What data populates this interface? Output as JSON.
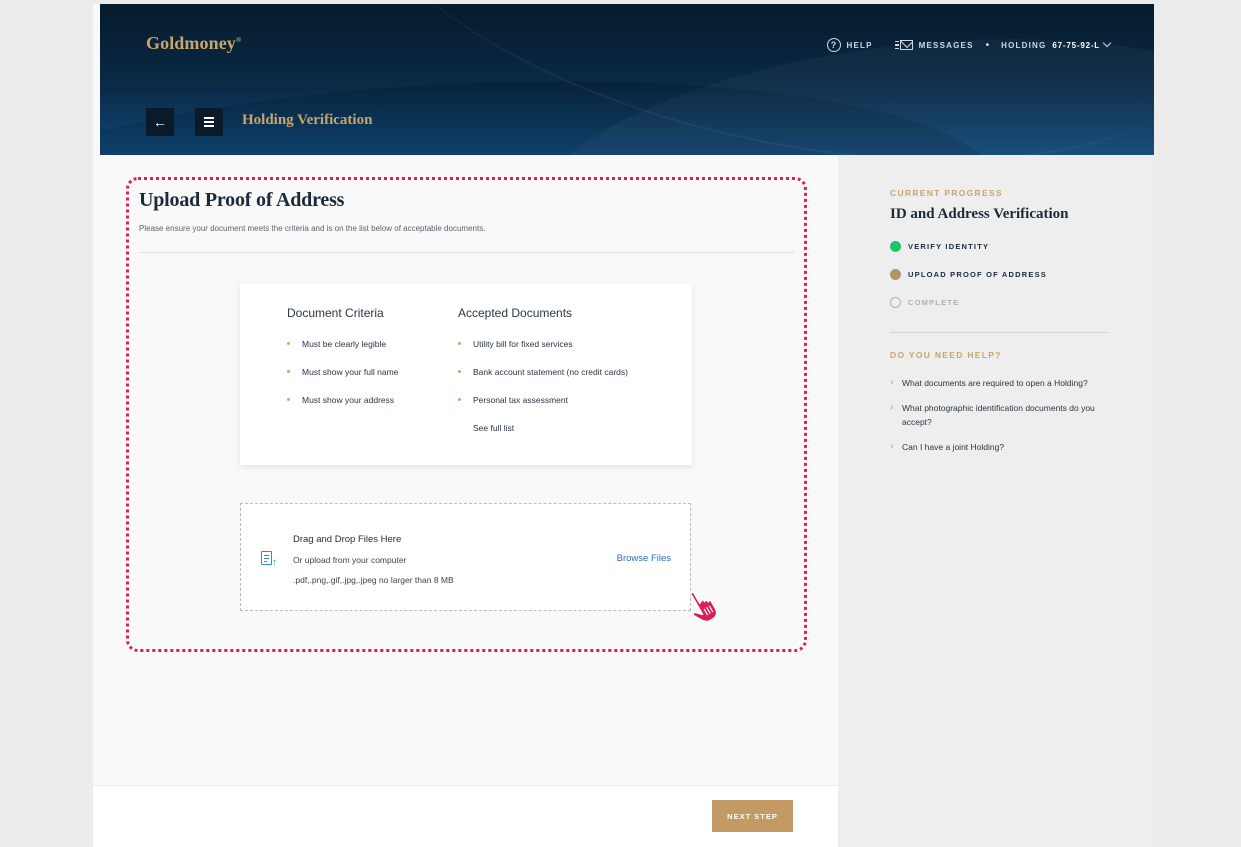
{
  "header": {
    "logo": "Goldmoney",
    "logo_mark": "®",
    "nav": {
      "help_icon": "?",
      "help_label": "HELP",
      "messages_label": "MESSAGES",
      "separator": "•",
      "holding_label": "HOLDING",
      "holding_number": "67-75-92-L"
    },
    "back_icon": "←",
    "page_title": "Holding Verification"
  },
  "main": {
    "title": "Upload Proof of Address",
    "subtitle": "Please ensure your document meets the criteria and is on the list below of acceptable documents.",
    "criteria": {
      "title": "Document Criteria",
      "items": [
        "Must be clearly legible",
        "Must show your full name",
        "Must show your address"
      ]
    },
    "accepted": {
      "title": "Accepted Documents",
      "items": [
        "Utility bill for fixed services",
        "Bank account statement (no credit cards)",
        "Personal tax assessment"
      ],
      "see_full_list": "See full list"
    },
    "upload": {
      "title": "Drag and Drop Files Here",
      "subtitle": "Or upload from your computer",
      "file_types": ".pdf,.png,.gif,.jpg,.jpeg no larger than 8 MB",
      "browse_label": "Browse Files",
      "arrow_icon": "↑"
    },
    "next_step_label": "NEXT STEP"
  },
  "sidebar": {
    "progress_label": "CURRENT PROGRESS",
    "progress_title": "ID and Address Verification",
    "steps": [
      {
        "label": "VERIFY IDENTITY",
        "status": "done",
        "color": "#1fc46d"
      },
      {
        "label": "UPLOAD PROOF OF ADDRESS",
        "status": "current",
        "color": "#b59366"
      },
      {
        "label": "COMPLETE",
        "status": "pending",
        "color": "#a9b2bc"
      }
    ],
    "help_label": "DO YOU NEED HELP?",
    "help_items": [
      "What documents are required to open a Holding?",
      "What photographic identification documents do you accept?",
      "Can I have a joint Holding?"
    ]
  },
  "colors": {
    "gold": "#c9a56b",
    "button_gold": "#c39a63",
    "highlight_border": "#d81e5b",
    "link_blue": "#2d6cc0",
    "cursor_pink": "#d81e5b"
  }
}
